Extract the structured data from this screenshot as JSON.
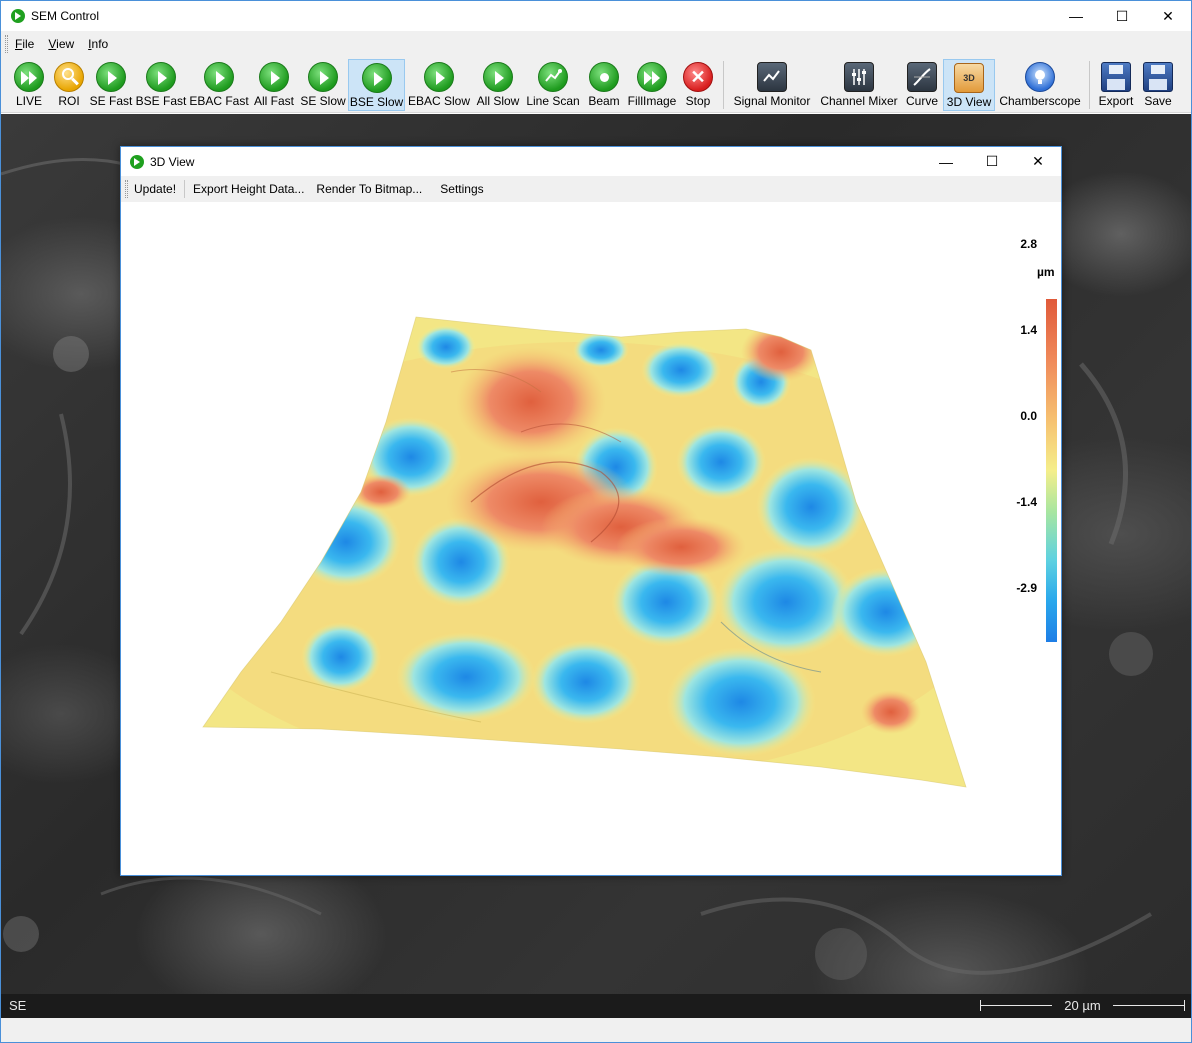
{
  "app": {
    "title": "SEM Control",
    "window_controls": {
      "minimize": "—",
      "maximize": "☐",
      "close": "✕"
    }
  },
  "menu": {
    "file": "File",
    "view": "View",
    "info": "Info"
  },
  "toolbar": {
    "buttons": [
      {
        "label": "LIVE",
        "icon": "fast-forward-icon"
      },
      {
        "label": "ROI",
        "icon": "magnifier-icon"
      },
      {
        "label": "SE Fast",
        "icon": "play-icon"
      },
      {
        "label": "BSE Fast",
        "icon": "play-icon"
      },
      {
        "label": "EBAC Fast",
        "icon": "play-icon"
      },
      {
        "label": "All Fast",
        "icon": "play-icon"
      },
      {
        "label": "SE Slow",
        "icon": "play-icon"
      },
      {
        "label": "BSE Slow",
        "icon": "play-icon",
        "active": true
      },
      {
        "label": "EBAC Slow",
        "icon": "play-icon"
      },
      {
        "label": "All Slow",
        "icon": "play-icon"
      },
      {
        "label": "Line Scan",
        "icon": "line-scan-icon"
      },
      {
        "label": "Beam",
        "icon": "beam-dot-icon"
      },
      {
        "label": "FillImage",
        "icon": "fast-forward-icon"
      },
      {
        "label": "Stop",
        "icon": "stop-x-icon"
      },
      {
        "label": "Signal Monitor",
        "icon": "signal-monitor-icon"
      },
      {
        "label": "Channel Mixer",
        "icon": "channel-mixer-icon"
      },
      {
        "label": "Curve",
        "icon": "curve-icon"
      },
      {
        "label": "3D View",
        "icon": "3d-view-icon",
        "active": true
      },
      {
        "label": "Chamberscope",
        "icon": "lightbulb-icon"
      },
      {
        "label": "Export",
        "icon": "floppy-disk-icon"
      },
      {
        "label": "Save",
        "icon": "floppy-disk-icon"
      }
    ]
  },
  "status": {
    "detector": "SE",
    "scale_bar": "20 µm"
  },
  "view3d": {
    "title": "3D View",
    "menu": {
      "update": "Update!",
      "export": "Export Height Data...",
      "render": "Render To Bitmap...",
      "settings": "Settings"
    },
    "colorbar": {
      "unit": "µm",
      "ticks": [
        "2.8",
        "1.4",
        "0.0",
        "-1.4",
        "-2.9"
      ],
      "colors": [
        "#e05a3a",
        "#f6c070",
        "#f5ee8a",
        "#5fd2e0",
        "#1e7ee6"
      ]
    }
  }
}
